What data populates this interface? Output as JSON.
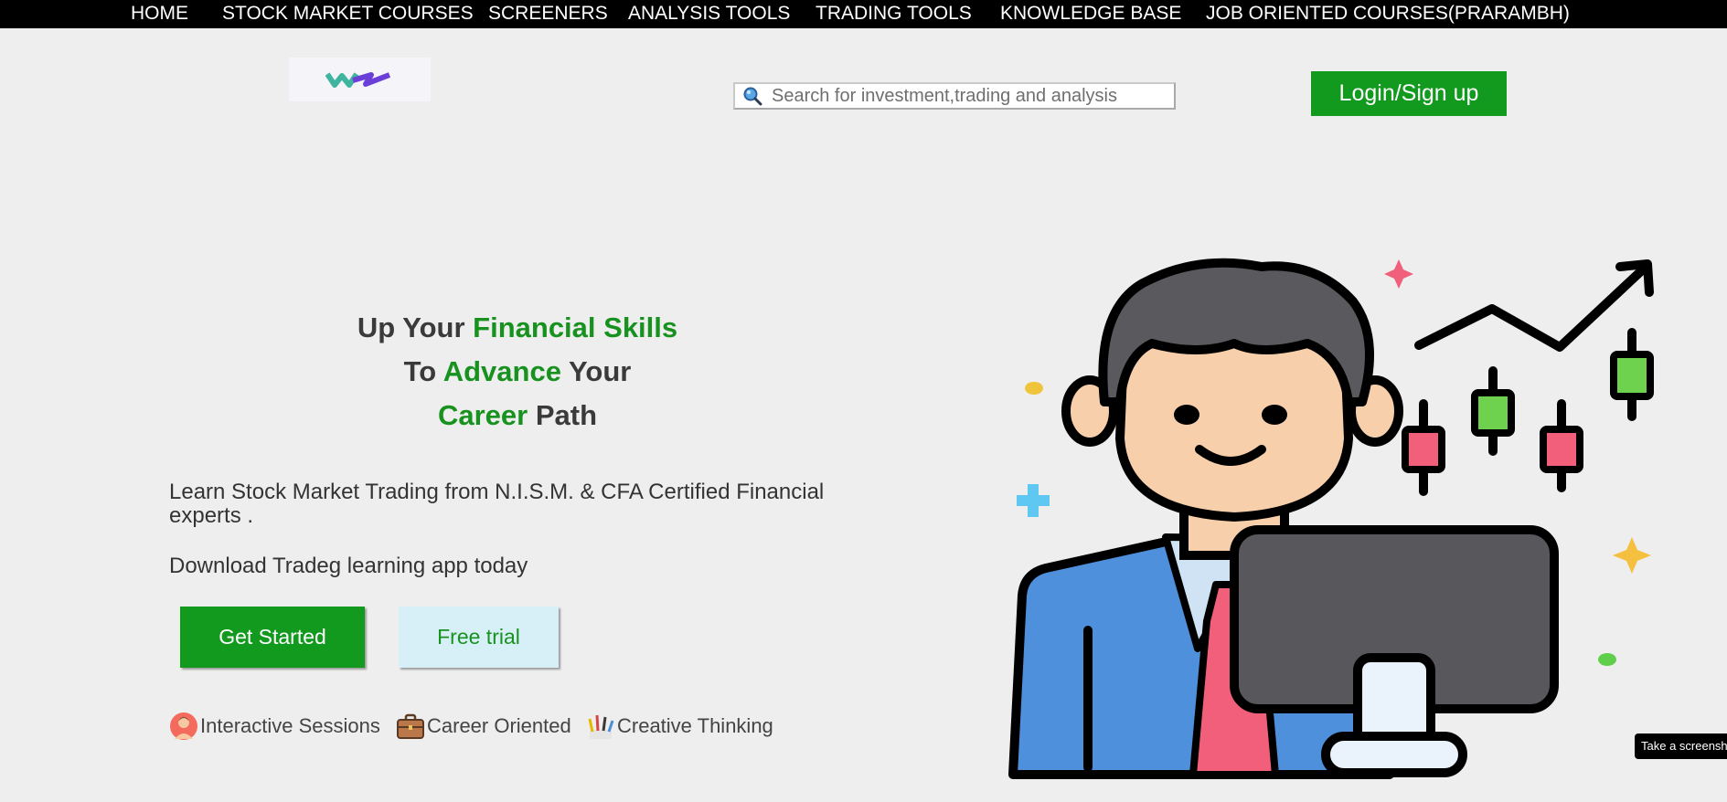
{
  "nav": {
    "items": [
      "HOME",
      "STOCK MARKET COURSES",
      "SCREENERS",
      "ANALYSIS TOOLS",
      "TRADING TOOLS",
      "KNOWLEDGE BASE",
      "JOB ORIENTED COURSES(PRARAMBH)"
    ]
  },
  "search": {
    "placeholder": "Search for investment,trading and analysis",
    "icon": "search-icon"
  },
  "header": {
    "login_label": "Login/Sign up",
    "accent_color": "#129a1f"
  },
  "hero": {
    "line1_a": "Up Your ",
    "line1_b": "Financial Skills",
    "line2_a": "To ",
    "line2_b": "Advance",
    "line2_c": " Your",
    "line3_a": "Career",
    "line3_b": " Path",
    "description": "Learn Stock Market Trading from N.I.S.M. & CFA Certified Financial experts .",
    "download_text": "Download Tradeg learning app today",
    "get_started_label": "Get Started",
    "free_trial_label": "Free trial"
  },
  "features": [
    {
      "label": "Interactive Sessions",
      "icon": "presenter-icon"
    },
    {
      "label": "Career Oriented",
      "icon": "briefcase-icon"
    },
    {
      "label": "Creative Thinking",
      "icon": "paint-brushes-icon"
    }
  ],
  "tooltip": {
    "text": "Take a screenshot"
  }
}
